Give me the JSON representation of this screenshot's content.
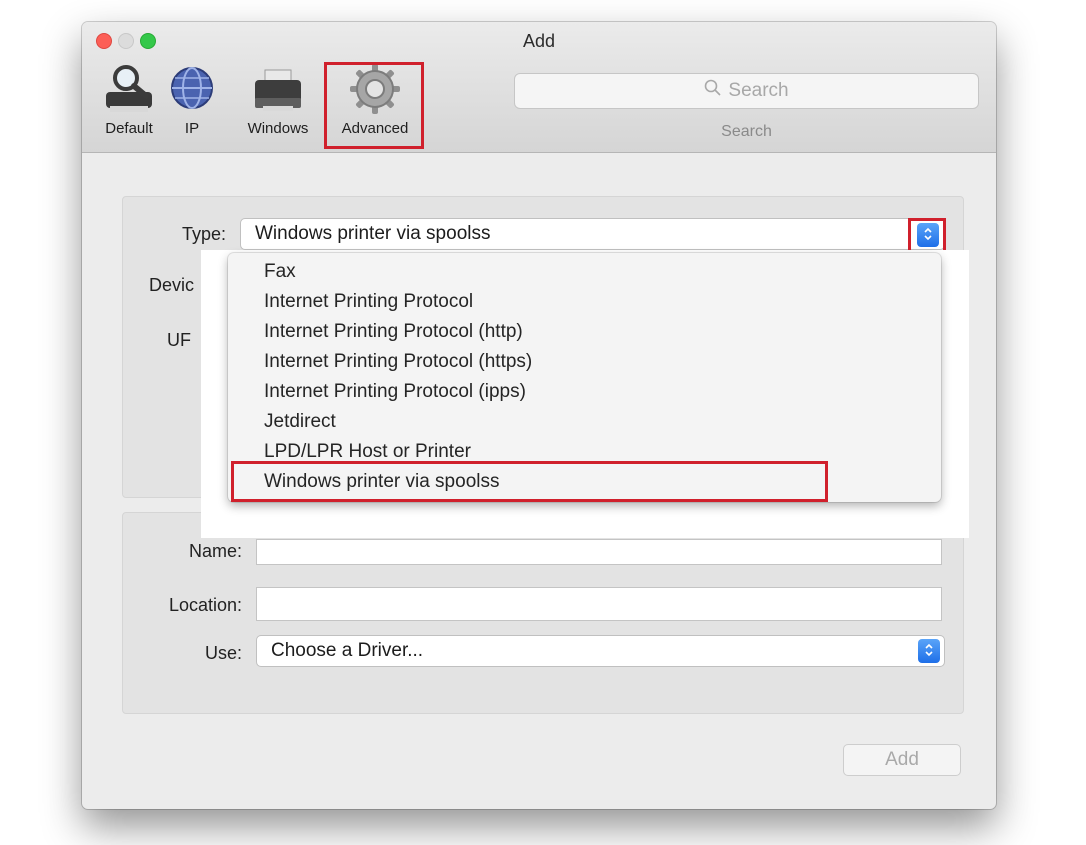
{
  "window": {
    "title": "Add"
  },
  "toolbar": {
    "items": [
      {
        "label": "Default",
        "icon": "magnifier-printer-icon"
      },
      {
        "label": "IP",
        "icon": "globe-icon"
      },
      {
        "label": "Windows",
        "icon": "printer-icon"
      },
      {
        "label": "Advanced",
        "icon": "gear-icon",
        "selected": true
      }
    ],
    "search": {
      "placeholder": "Search",
      "label": "Search"
    }
  },
  "form": {
    "type_label": "Type:",
    "type_value": "Windows printer via spoolss",
    "device_label": "Devic",
    "url_label": "UF",
    "name_label": "Name:",
    "name_value": "",
    "location_label": "Location:",
    "location_value": "",
    "use_label": "Use:",
    "use_value": "Choose a Driver..."
  },
  "dropdown": {
    "items": [
      "Fax",
      "Internet Printing Protocol",
      "Internet Printing Protocol (http)",
      "Internet Printing Protocol (https)",
      "Internet Printing Protocol (ipps)",
      "Jetdirect",
      "LPD/LPR Host or Printer",
      "Windows printer via spoolss"
    ],
    "selected": "Windows printer via spoolss"
  },
  "buttons": {
    "add": "Add"
  },
  "colors": {
    "highlight_box": "#d0202c",
    "stepper_blue": "#1e6fe8",
    "close": "#fc5f57",
    "zoom": "#34c84a"
  }
}
